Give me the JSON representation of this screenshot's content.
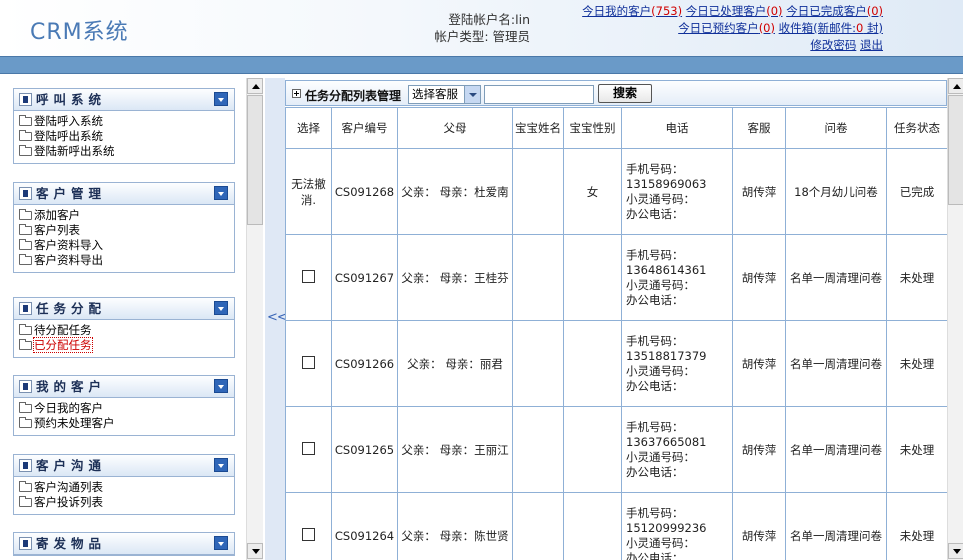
{
  "header": {
    "logo": "CRM系统",
    "login_account": "登陆帐户名:lin",
    "account_type": "帐户类型: 管理员",
    "links": {
      "today_my_customers": "今日我的客户",
      "today_my_customers_count": "(753)",
      "today_processed": "今日已处理客户",
      "today_processed_count": "(0)",
      "today_completed": "今日已完成客户",
      "today_completed_count": "(0)",
      "today_booked": "今日已预约客户",
      "today_booked_count": "(0)",
      "inbox": "收件箱(新邮件:",
      "inbox_count": "0",
      "inbox_suffix": " 封)",
      "change_password": "修改密码",
      "logout": "退出"
    }
  },
  "sidebar": {
    "groups": [
      {
        "title": "呼叫系统",
        "items": [
          "登陆呼入系统",
          "登陆呼出系统",
          "登陆新呼出系统"
        ]
      },
      {
        "title": "客户管理",
        "items": [
          "添加客户",
          "客户列表",
          "客户资料导入",
          "客户资料导出"
        ]
      },
      {
        "title": "任务分配",
        "items": [
          "待分配任务",
          "已分配任务"
        ]
      },
      {
        "title": "我的客户",
        "items": [
          "今日我的客户",
          "预约未处理客户"
        ]
      },
      {
        "title": "客户沟通",
        "items": [
          "客户沟通列表",
          "客户投诉列表"
        ]
      },
      {
        "title": "寄发物品",
        "items": []
      }
    ]
  },
  "splitter": {
    "label": "<<"
  },
  "toolbar": {
    "title": "任务分配列表管理",
    "select_value": "选择客服",
    "search_value": "",
    "search_button": "搜索"
  },
  "table": {
    "columns": [
      "选择",
      "客户编号",
      "父母",
      "宝宝姓名",
      "宝宝性别",
      "电话",
      "客服",
      "问卷",
      "任务状态"
    ],
    "rows": [
      {
        "select": "无法撤消.",
        "id": "CS091268",
        "parents": "父亲： 母亲：杜爱南",
        "baby_name": "",
        "baby_gender": "女",
        "mobile_label": "手机号码：",
        "mobile": "13158969063",
        "xlt_label": "小灵通号码：",
        "office_label": "办公电话：",
        "agent": "胡传萍",
        "survey": "18个月幼儿问卷",
        "status": "已完成"
      },
      {
        "select": "",
        "id": "CS091267",
        "parents": "父亲： 母亲：王桂芬",
        "baby_name": "",
        "baby_gender": "",
        "mobile_label": "手机号码：",
        "mobile": "13648614361",
        "xlt_label": "小灵通号码：",
        "office_label": "办公电话：",
        "agent": "胡传萍",
        "survey": "名单一周清理问卷",
        "status": "未处理"
      },
      {
        "select": "",
        "id": "CS091266",
        "parents": "父亲： 母亲：丽君",
        "baby_name": "",
        "baby_gender": "",
        "mobile_label": "手机号码：",
        "mobile": "13518817379",
        "xlt_label": "小灵通号码：",
        "office_label": "办公电话：",
        "agent": "胡传萍",
        "survey": "名单一周清理问卷",
        "status": "未处理"
      },
      {
        "select": "",
        "id": "CS091265",
        "parents": "父亲： 母亲：王丽江",
        "baby_name": "",
        "baby_gender": "",
        "mobile_label": "手机号码：",
        "mobile": "13637665081",
        "xlt_label": "小灵通号码：",
        "office_label": "办公电话：",
        "agent": "胡传萍",
        "survey": "名单一周清理问卷",
        "status": "未处理"
      },
      {
        "select": "",
        "id": "CS091264",
        "parents": "父亲： 母亲：陈世贤",
        "baby_name": "",
        "baby_gender": "",
        "mobile_label": "手机号码：",
        "mobile": "15120999236",
        "xlt_label": "小灵通号码：",
        "office_label": "办公电话：",
        "agent": "胡传萍",
        "survey": "名单一周清理问卷",
        "status": "未处理"
      }
    ]
  }
}
